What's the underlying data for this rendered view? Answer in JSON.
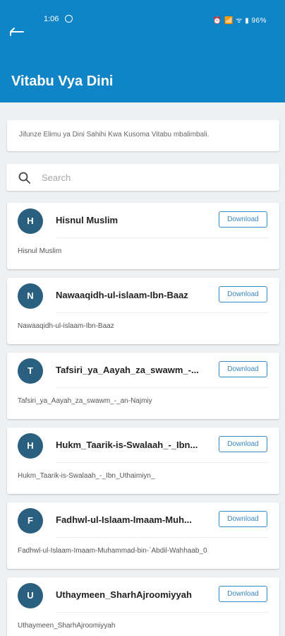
{
  "status_bar": {
    "time": "1:06",
    "indicators": "⏰ 📶 ᯤ ▮ 96%"
  },
  "app_bar": {
    "back_icon": "back-arrow-icon",
    "title": "Vitabu Vya Dini",
    "color": "#0f84c7"
  },
  "intro": {
    "text": "Jifunze Elimu ya Dini Sahihi Kwa Kusoma Vitabu mbalimbali."
  },
  "search": {
    "placeholder": "Search",
    "value": ""
  },
  "books": [
    {
      "initial": "H",
      "title": "Hisnul Muslim",
      "subtitle": "Hisnul Muslim",
      "button": "Download"
    },
    {
      "initial": "N",
      "title": "Nawaaqidh-ul-islaam-Ibn-Baaz",
      "subtitle": "Nawaaqidh-ul-islaam-Ibn-Baaz",
      "button": "Download"
    },
    {
      "initial": "T",
      "title": "Tafsiri_ya_Aayah_za_swawm_-...",
      "subtitle": "Tafsiri_ya_Aayah_za_swawm_-_an-Najmiy",
      "button": "Download"
    },
    {
      "initial": "H",
      "title": "Hukm_Taarik-is-Swalaah_-_Ibn...",
      "subtitle": "Hukm_Taarik-is-Swalaah_-_Ibn_Uthaimiyn_",
      "button": "Download"
    },
    {
      "initial": "F",
      "title": "Fadhwl-ul-Islaam-Imaam-Muh...",
      "subtitle": "Fadhwl-ul-Islaam-Imaam-Muhammad-bin-`Abdil-Wahhaab_0",
      "button": "Download"
    },
    {
      "initial": "U",
      "title": "Uthaymeen_SharhAjroomiyyah",
      "subtitle": "Uthaymeen_SharhAjroomiyyah",
      "button": "Download"
    }
  ],
  "colors": {
    "avatar": "#2a5f80",
    "button_border": "#3a88c2",
    "background": "#eef1f4"
  }
}
